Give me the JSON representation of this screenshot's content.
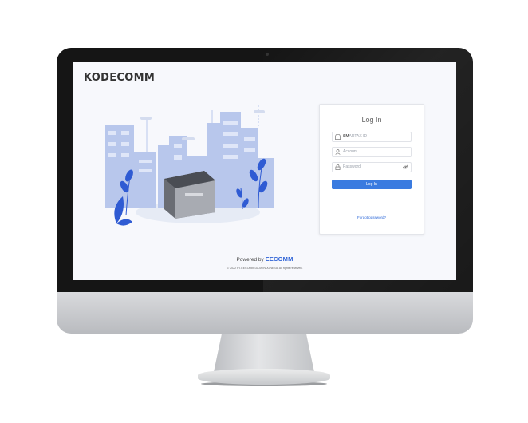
{
  "brand": {
    "name": "KODECOMM"
  },
  "login": {
    "title": "Log In",
    "fields": [
      {
        "icon": "store-icon",
        "placeholder_bold": "SM",
        "placeholder": "ARTAX ID"
      },
      {
        "icon": "user-icon",
        "placeholder": "Account"
      },
      {
        "icon": "lock-icon",
        "placeholder": "Password",
        "trailing_icon": "eye-off-icon"
      }
    ],
    "button_label": "Log In",
    "forgot_label": "Forgot password?"
  },
  "footer": {
    "powered_by": "Powered by",
    "powered_logo": "EECOMM",
    "copyright": "© 2022 PT.EECOMM DATA INDONESIA All rights reserved."
  },
  "colors": {
    "accent": "#3a7be0",
    "link": "#2a66d8",
    "illustration_buildings": "#b8c7ec",
    "illustration_plants": "#2f5bd3"
  }
}
